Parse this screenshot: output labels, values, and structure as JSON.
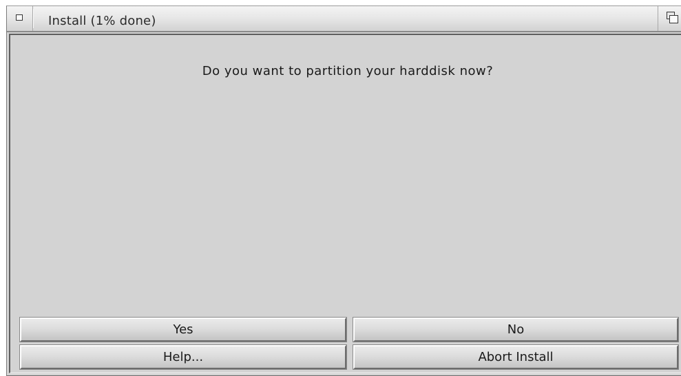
{
  "window": {
    "title": "Install (1% done)"
  },
  "dialog": {
    "question": "Do you want to partition your harddisk now?"
  },
  "buttons": {
    "yes": "Yes",
    "no": "No",
    "help": "Help...",
    "abort": "Abort Install"
  },
  "icons": {
    "close": "close-gadget-icon",
    "depth": "depth-arrange-icon"
  },
  "colors": {
    "window_bg": "#d4d4d4",
    "text": "#1a1a1a"
  }
}
